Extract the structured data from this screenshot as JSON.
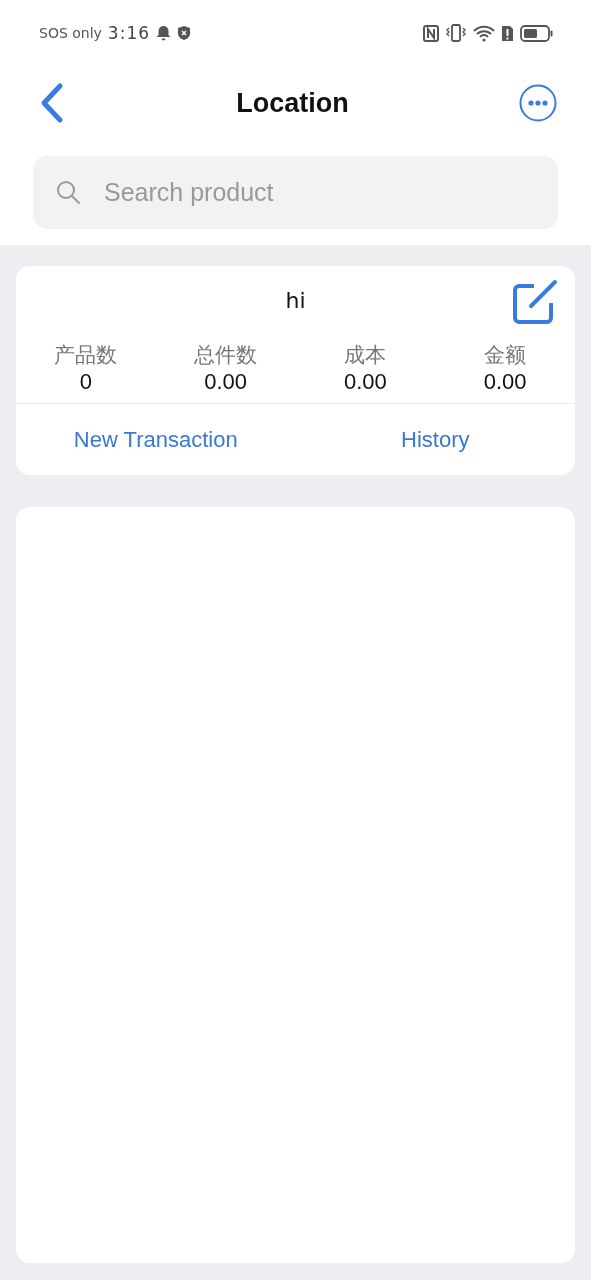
{
  "status_bar": {
    "carrier": "SOS only",
    "time": "3:16"
  },
  "header": {
    "title": "Location"
  },
  "search": {
    "placeholder": "Search product"
  },
  "location_card": {
    "name": "hi",
    "stats": [
      {
        "label": "产品数",
        "value": "0"
      },
      {
        "label": "总件数",
        "value": "0.00"
      },
      {
        "label": "成本",
        "value": "0.00"
      },
      {
        "label": "金额",
        "value": "0.00"
      }
    ],
    "actions": [
      "New Transaction",
      "History"
    ]
  }
}
